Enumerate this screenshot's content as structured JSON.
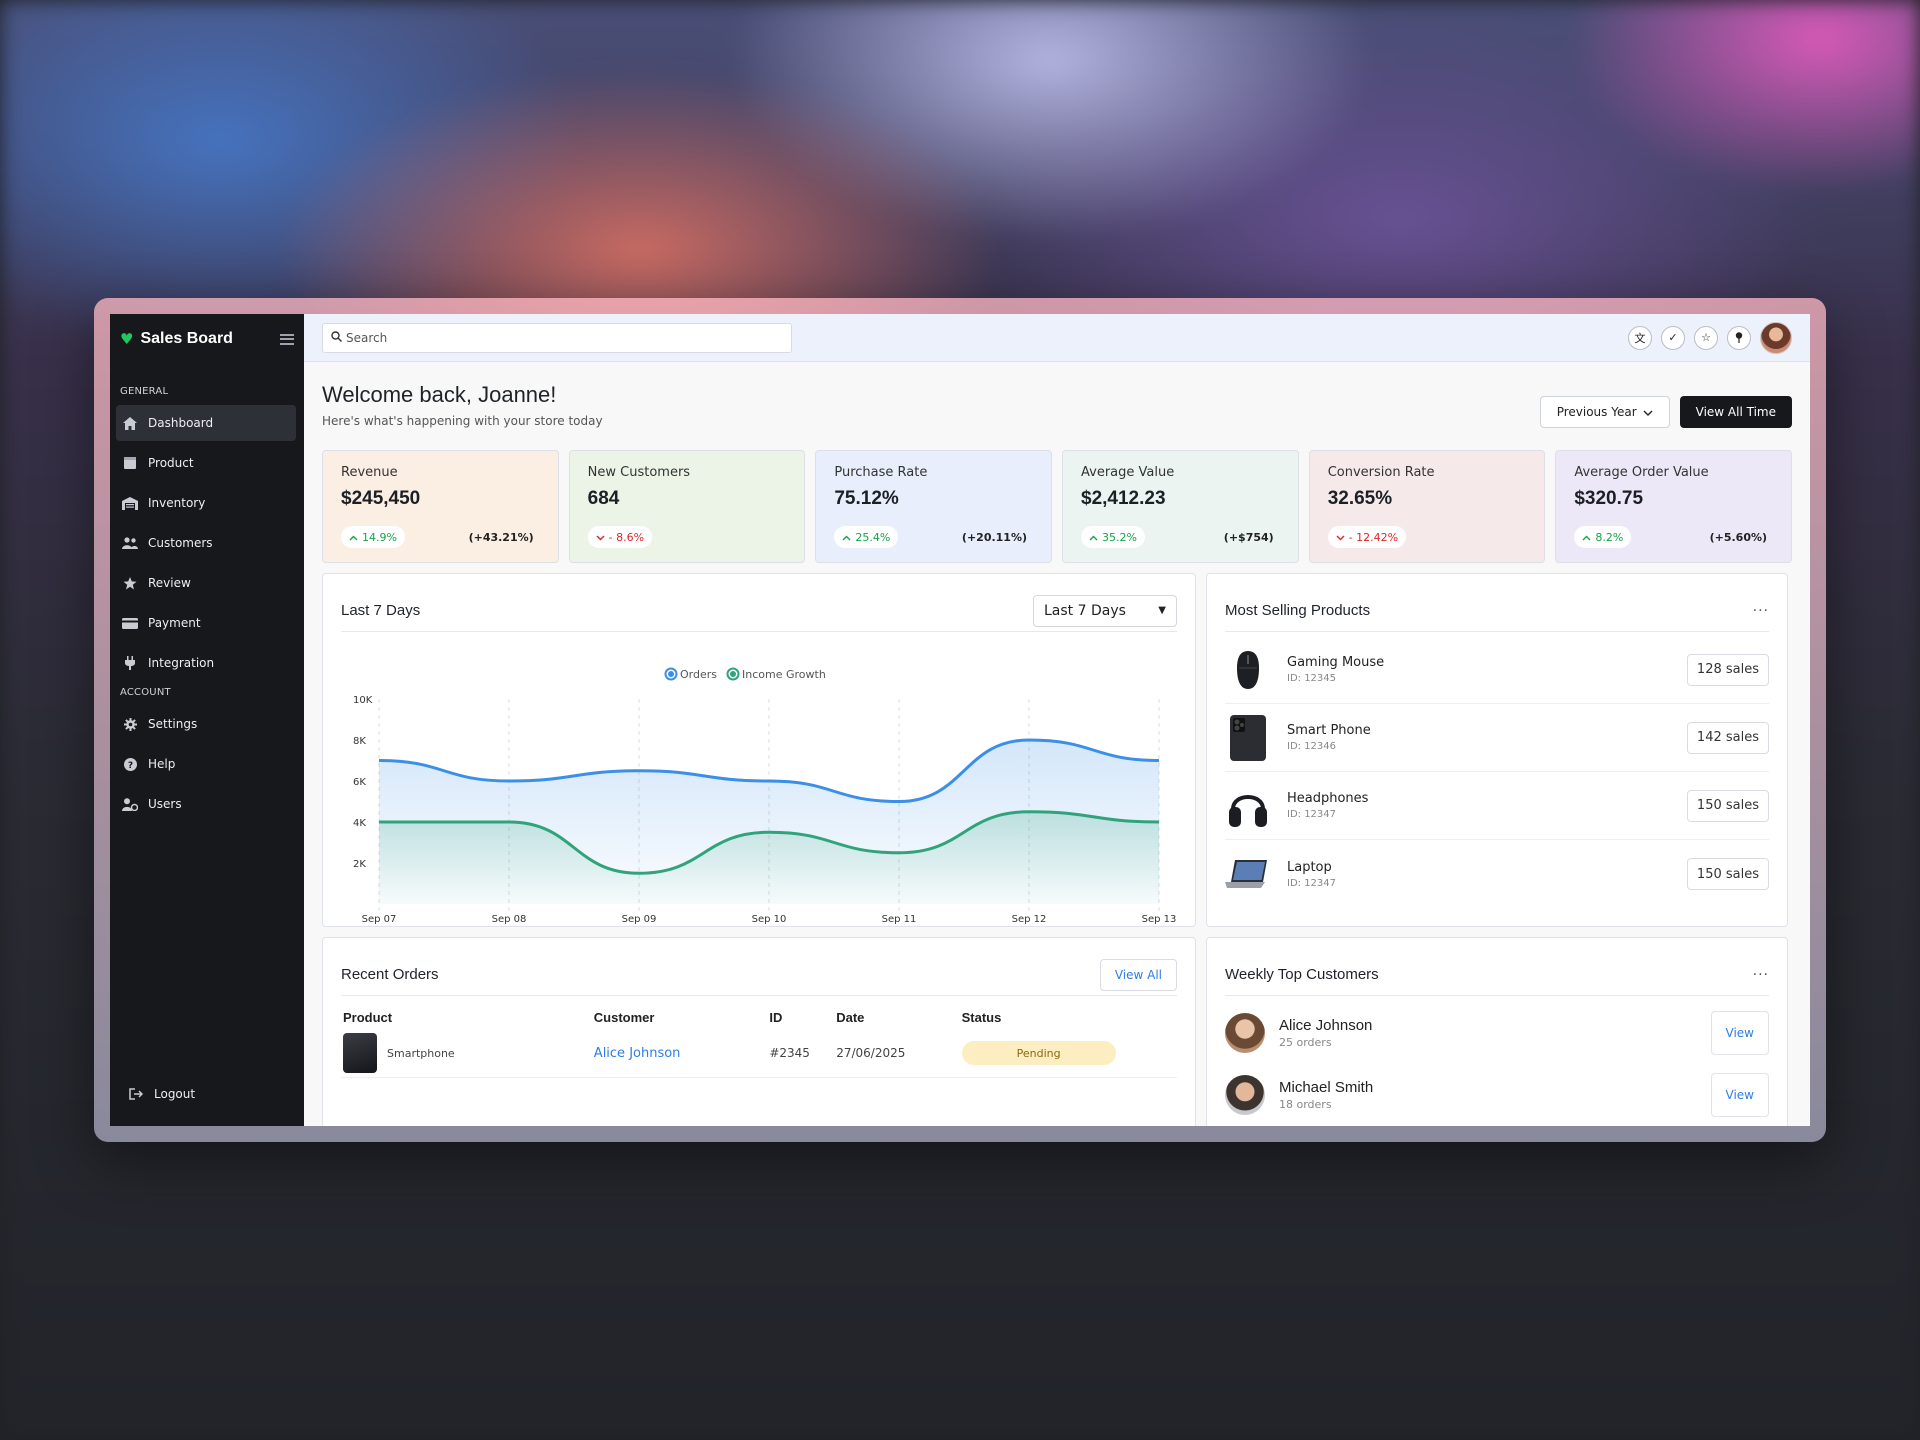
{
  "brand": {
    "name": "Sales Board"
  },
  "sidebar": {
    "general_label": "GENERAL",
    "account_label": "ACCOUNT",
    "general_items": [
      {
        "label": "Dashboard",
        "icon": "home-icon"
      },
      {
        "label": "Product",
        "icon": "box-icon"
      },
      {
        "label": "Inventory",
        "icon": "warehouse-icon"
      },
      {
        "label": "Customers",
        "icon": "users-icon"
      },
      {
        "label": "Review",
        "icon": "star-icon"
      },
      {
        "label": "Payment",
        "icon": "card-icon"
      },
      {
        "label": "Integration",
        "icon": "plug-icon"
      }
    ],
    "account_items": [
      {
        "label": "Settings",
        "icon": "gear-icon"
      },
      {
        "label": "Help",
        "icon": "help-icon"
      },
      {
        "label": "Users",
        "icon": "user-cog-icon"
      }
    ],
    "logout_label": "Logout"
  },
  "search": {
    "placeholder": "Search"
  },
  "header": {
    "title": "Welcome back, Joanne!",
    "subtitle": "Here's what's happening with your store today",
    "period_button": "Previous Year",
    "view_all_time": "View All Time"
  },
  "kpis": [
    {
      "label": "Revenue",
      "value": "$245,450",
      "chip": "14.9%",
      "trend": "up",
      "delta": "(+43.21%)",
      "bg": "#fbeee3"
    },
    {
      "label": "New Customers",
      "value": "684",
      "chip": "- 8.6%",
      "trend": "down",
      "delta": "",
      "bg": "#ecf4e8"
    },
    {
      "label": "Purchase Rate",
      "value": "75.12%",
      "chip": "25.4%",
      "trend": "up",
      "delta": "(+20.11%)",
      "bg": "#e8eefb"
    },
    {
      "label": "Average Value",
      "value": "$2,412.23",
      "chip": "35.2%",
      "trend": "up",
      "delta": "(+$754)",
      "bg": "#ebf4f1"
    },
    {
      "label": "Conversion Rate",
      "value": "32.65%",
      "chip": "- 12.42%",
      "trend": "down",
      "delta": "",
      "bg": "#f6e9ea"
    },
    {
      "label": "Average Order Value",
      "value": "$320.75",
      "chip": "8.2%",
      "trend": "up",
      "delta": "(+5.60%)",
      "bg": "#ede8f7"
    }
  ],
  "chart_panel": {
    "title": "Last 7 Days",
    "dropdown": "Last 7 Days"
  },
  "chart_data": {
    "type": "area",
    "categories": [
      "Sep 07",
      "Sep 08",
      "Sep 09",
      "Sep 10",
      "Sep 11",
      "Sep 12",
      "Sep 13"
    ],
    "yticks": [
      "10K",
      "8K",
      "6K",
      "4K",
      "2K"
    ],
    "ylim": [
      0,
      10000
    ],
    "grid": "vertical dashed",
    "legend_position": "top-center",
    "series": [
      {
        "name": "Orders",
        "color": "#3b8fe6",
        "values": [
          7000,
          6000,
          6500,
          6000,
          5000,
          8000,
          7000
        ]
      },
      {
        "name": "Income Growth",
        "color": "#2fa37a",
        "values": [
          4000,
          4000,
          1500,
          3500,
          2500,
          4500,
          4000
        ]
      }
    ]
  },
  "products_panel": {
    "title": "Most Selling Products",
    "items": [
      {
        "name": "Gaming Mouse",
        "id": "ID: 12345",
        "sales": "128 sales",
        "icon": "mouse-icon"
      },
      {
        "name": "Smart Phone",
        "id": "ID: 12346",
        "sales": "142 sales",
        "icon": "phone-icon"
      },
      {
        "name": "Headphones",
        "id": "ID: 12347",
        "sales": "150 sales",
        "icon": "headphones-icon"
      },
      {
        "name": "Laptop",
        "id": "ID: 12347",
        "sales": "150 sales",
        "icon": "laptop-icon"
      }
    ]
  },
  "orders_panel": {
    "title": "Recent Orders",
    "view_all": "View All",
    "columns": [
      "Product",
      "Customer",
      "ID",
      "Date",
      "Status"
    ],
    "rows": [
      {
        "product": "Smartphone",
        "customer": "Alice Johnson",
        "id": "#2345",
        "date": "27/06/2025",
        "status": "Pending"
      }
    ]
  },
  "customers_panel": {
    "title": "Weekly Top Customers",
    "view_label": "View",
    "items": [
      {
        "name": "Alice Johnson",
        "orders": "25 orders"
      },
      {
        "name": "Michael Smith",
        "orders": "18 orders"
      }
    ]
  }
}
